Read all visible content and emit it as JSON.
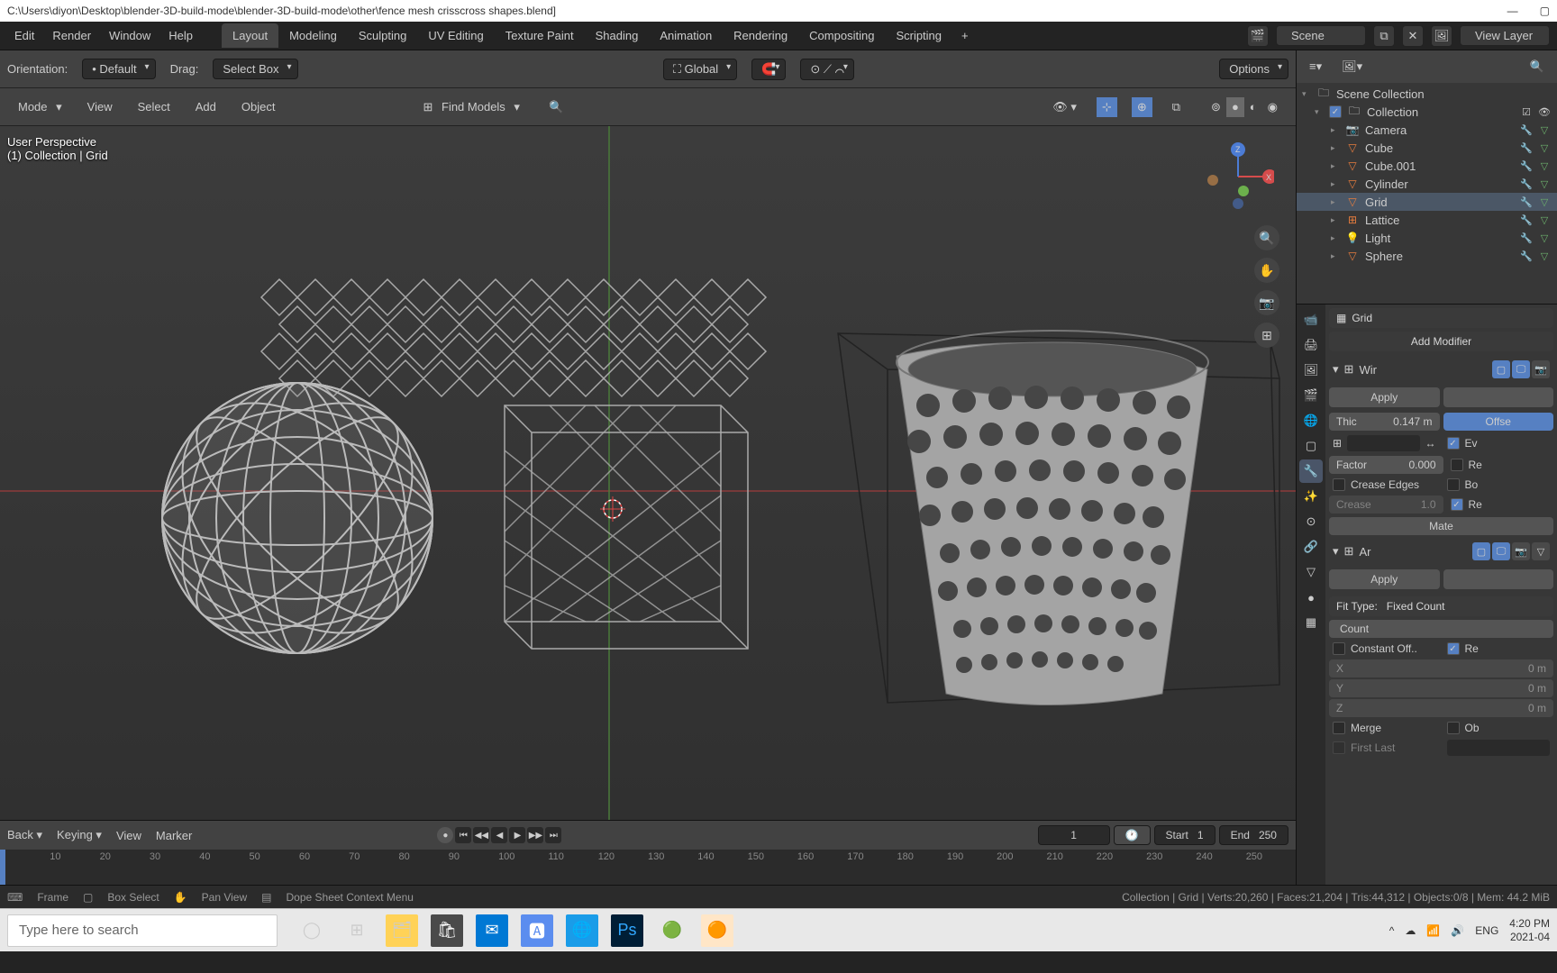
{
  "title": "C:\\Users\\diyon\\Desktop\\blender-3D-build-mode\\blender-3D-build-mode\\other\\fence mesh crisscross shapes.blend]",
  "topmenu": {
    "edit": "Edit",
    "render": "Render",
    "window": "Window",
    "help": "Help"
  },
  "workspaces": [
    "Layout",
    "Modeling",
    "Sculpting",
    "UV Editing",
    "Texture Paint",
    "Shading",
    "Animation",
    "Rendering",
    "Compositing",
    "Scripting"
  ],
  "scene_bar": {
    "scene": "Scene",
    "view_layer": "View Layer"
  },
  "subheader": {
    "orientation": "Orientation:",
    "orient_val": "Default",
    "drag": "Drag:",
    "drag_val": "Select Box",
    "global": "Global",
    "find": "Find Models"
  },
  "subheader2": {
    "mode": "Mode",
    "view": "View",
    "select": "Select",
    "add": "Add",
    "object": "Object"
  },
  "viewport_overlay": {
    "line1": "User Perspective",
    "line2": "(1) Collection | Grid"
  },
  "options_btn": "Options",
  "timeline": {
    "back": "Back",
    "keying": "Keying",
    "view": "View",
    "marker": "Marker",
    "cur": "1",
    "start_l": "Start",
    "start_v": "1",
    "end_l": "End",
    "end_v": "250",
    "ticks": [
      10,
      20,
      30,
      40,
      50,
      60,
      70,
      80,
      90,
      100,
      110,
      120,
      130,
      140,
      150,
      160,
      170,
      180,
      190,
      200,
      210,
      220,
      230,
      240,
      250
    ]
  },
  "outliner": {
    "root": "Scene Collection",
    "collection": "Collection",
    "items": [
      {
        "name": "Camera",
        "icon": "📷"
      },
      {
        "name": "Cube",
        "icon": "▽"
      },
      {
        "name": "Cube.001",
        "icon": "▽"
      },
      {
        "name": "Cylinder",
        "icon": "▽"
      },
      {
        "name": "Grid",
        "icon": "▽",
        "sel": true
      },
      {
        "name": "Lattice",
        "icon": "⊞"
      },
      {
        "name": "Light",
        "icon": "💡"
      },
      {
        "name": "Sphere",
        "icon": "▽"
      }
    ]
  },
  "props": {
    "crumb": "Grid",
    "add_mod": "Add Modifier",
    "mod1": {
      "name": "Wir",
      "apply": "Apply",
      "thick_l": "Thic",
      "thick_v": "0.147 m",
      "offset": "Offse",
      "ev": "Ev",
      "factor_l": "Factor",
      "factor_v": "0.000",
      "re": "Re",
      "crease_edges": "Crease Edges",
      "bo": "Bo",
      "crease_l": "Crease",
      "crease_v": "1.0",
      "re2": "Re",
      "mat": "Mate"
    },
    "mod2": {
      "name": "Ar",
      "apply": "Apply",
      "fit_l": "Fit Type:",
      "fit_v": "Fixed Count",
      "count": "Count",
      "const": "Constant Off..",
      "re": "Re",
      "x": "X",
      "y": "Y",
      "z": "Z",
      "xv": "0 m",
      "yv": "0 m",
      "zv": "0 m",
      "merge": "Merge",
      "ob": "Ob",
      "first": "First Last"
    }
  },
  "statusbar": {
    "frame": "Frame",
    "box": "Box Select",
    "pan": "Pan View",
    "dope": "Dope Sheet Context Menu",
    "right": "Collection | Grid | Verts:20,260 | Faces:21,204 | Tris:44,312 | Objects:0/8 | Mem: 44.2 MiB"
  },
  "taskbar": {
    "search": "Type here to search",
    "lang": "ENG",
    "time": "4:20 PM",
    "date": "2021-04"
  }
}
